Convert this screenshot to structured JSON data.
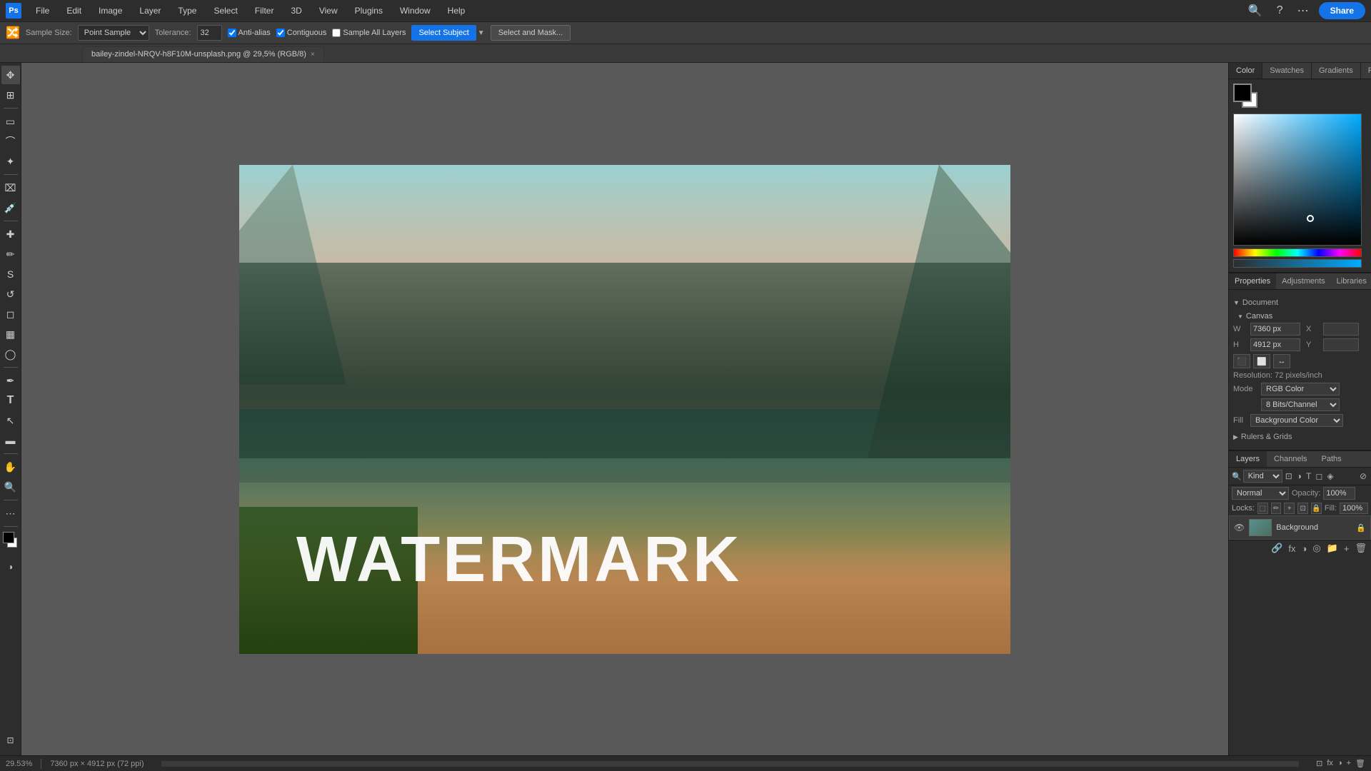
{
  "app": {
    "title": "Adobe Photoshop",
    "icon_label": "Ps"
  },
  "menu": {
    "items": [
      "File",
      "Edit",
      "Image",
      "Layer",
      "Type",
      "Select",
      "Filter",
      "3D",
      "View",
      "Plugins",
      "Window",
      "Help"
    ],
    "share_label": "Share"
  },
  "options_bar": {
    "sample_size_label": "Sample Size:",
    "sample_size_value": "Point Sample",
    "tolerance_label": "Tolerance:",
    "tolerance_value": "32",
    "anti_alias_label": "Anti-alias",
    "contiguous_label": "Contiguous",
    "sample_all_layers_label": "Sample All Layers",
    "select_subject_label": "Select Subject",
    "select_and_mask_label": "Select and Mask..."
  },
  "tab": {
    "filename": "bailey-zindel-NRQV-h8F10M-unsplash.png @ 29,5% (RGB/8)",
    "close_label": "×"
  },
  "canvas": {
    "watermark": "WATERMARK",
    "zoom": "29.53%",
    "dimensions": "7360 px × 4912 px (72 ppi)"
  },
  "color_panel": {
    "tabs": [
      "Color",
      "Swatches",
      "Gradients",
      "Patterns"
    ],
    "active_tab": "Color"
  },
  "properties_panel": {
    "tabs": [
      "Properties",
      "Adjustments",
      "Libraries"
    ],
    "active_tab": "Properties",
    "doc_section": "Document",
    "canvas_section": "Canvas",
    "width_label": "W",
    "width_value": "7360 px",
    "height_label": "H",
    "height_value": "4912 px",
    "x_label": "X",
    "y_label": "Y",
    "resolution_text": "Resolution: 72 pixels/inch",
    "mode_label": "Mode",
    "mode_value": "RGB Color",
    "bits_value": "8 Bits/Channel",
    "fill_label": "Fill",
    "fill_value": "Background Color",
    "rulers_grids": "Rulers & Grids"
  },
  "layers_panel": {
    "tabs": [
      "Layers",
      "Channels",
      "Paths"
    ],
    "active_tab": "Layers",
    "search_placeholder": "Kind",
    "blend_mode": "Normal",
    "opacity_label": "Opacity:",
    "opacity_value": "100%",
    "fill_label": "Fill:",
    "fill_value": "100%",
    "locks_label": "Locks:",
    "layers": [
      {
        "name": "Background",
        "visible": true,
        "locked": true
      }
    ]
  },
  "status_bar": {
    "zoom": "29.53%",
    "info": "7360 px × 4912 px (72 ppi)"
  },
  "tools": [
    {
      "name": "move",
      "icon": "✥"
    },
    {
      "name": "artboard",
      "icon": "⊞"
    },
    {
      "name": "marquee",
      "icon": "▭"
    },
    {
      "name": "lasso",
      "icon": "⌒"
    },
    {
      "name": "magic-wand",
      "icon": "✦"
    },
    {
      "name": "crop",
      "icon": "⌧"
    },
    {
      "name": "eyedropper",
      "icon": "🖊"
    },
    {
      "name": "spot-healing",
      "icon": "✚"
    },
    {
      "name": "brush",
      "icon": "✏"
    },
    {
      "name": "clone-stamp",
      "icon": "✉"
    },
    {
      "name": "history-brush",
      "icon": "↺"
    },
    {
      "name": "eraser",
      "icon": "◻"
    },
    {
      "name": "gradient",
      "icon": "▦"
    },
    {
      "name": "dodge",
      "icon": "◯"
    },
    {
      "name": "pen",
      "icon": "✒"
    },
    {
      "name": "text",
      "icon": "T"
    },
    {
      "name": "path-select",
      "icon": "↖"
    },
    {
      "name": "shape",
      "icon": "▬"
    },
    {
      "name": "hand",
      "icon": "✋"
    },
    {
      "name": "zoom",
      "icon": "🔍"
    },
    {
      "name": "more",
      "icon": "⋯"
    },
    {
      "name": "fg-bg-colors",
      "icon": ""
    },
    {
      "name": "mask",
      "icon": "◑"
    }
  ]
}
